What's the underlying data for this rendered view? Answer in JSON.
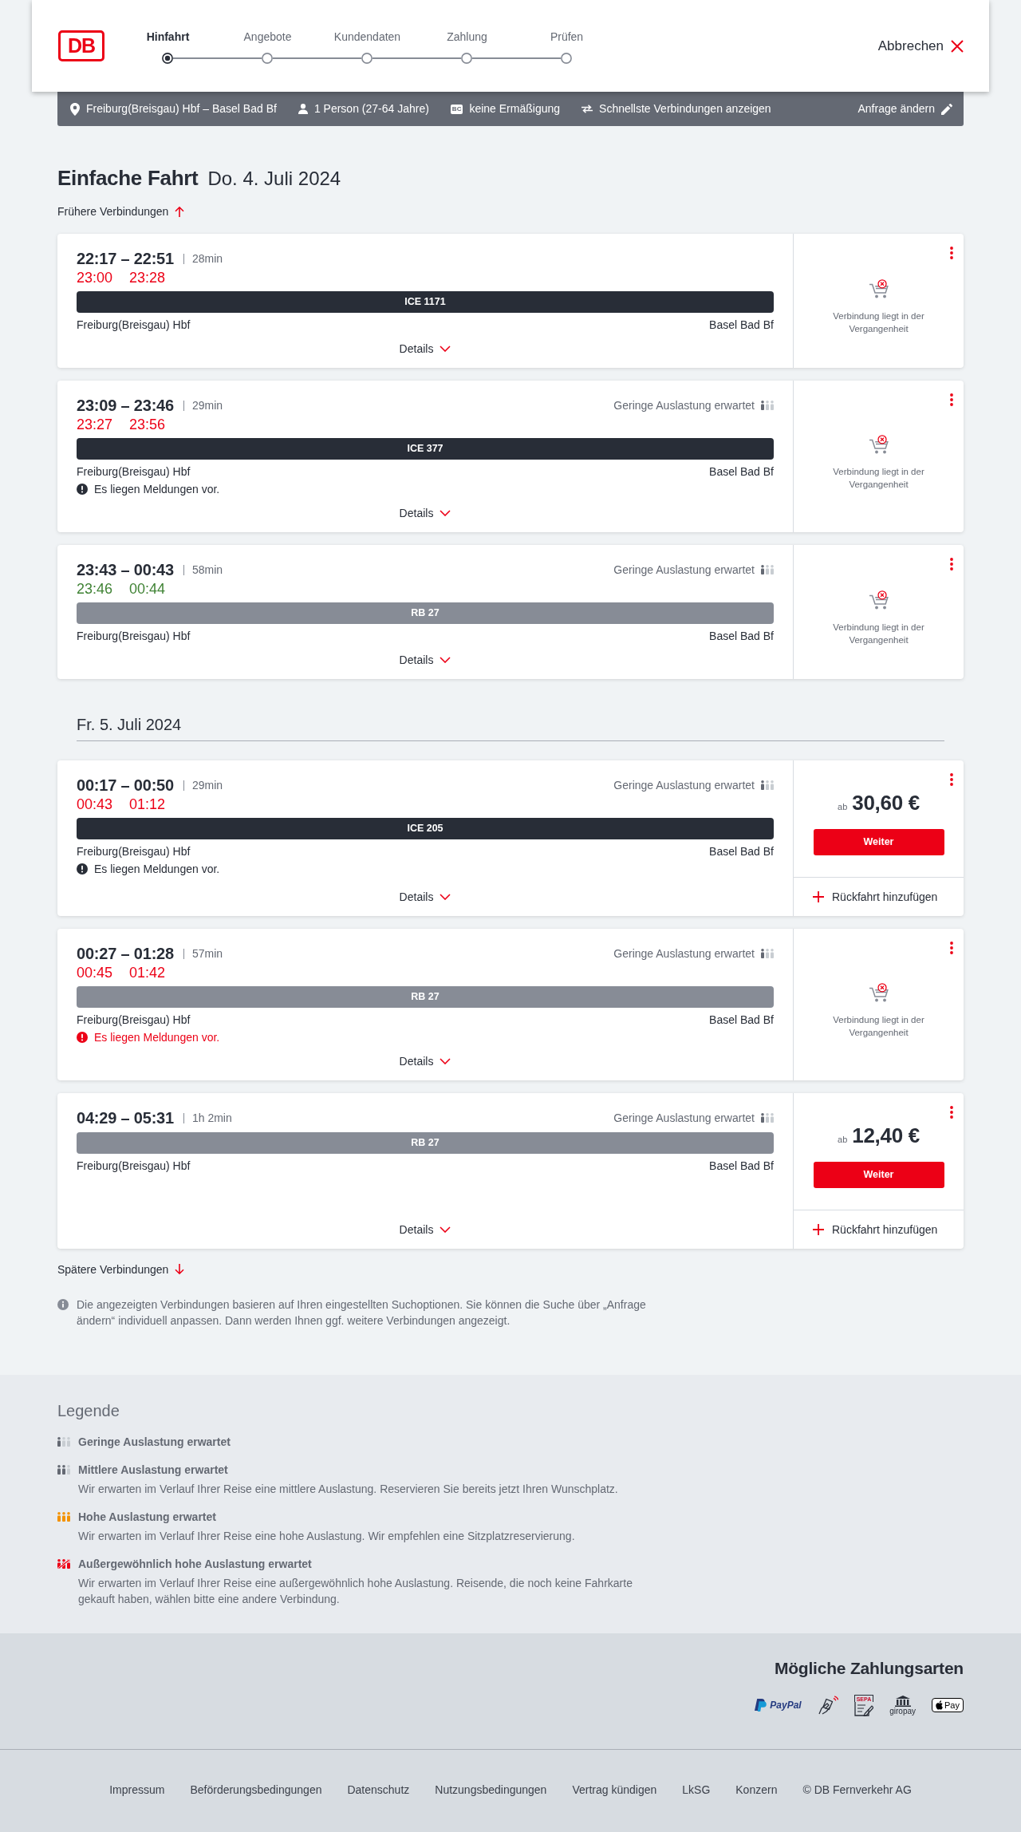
{
  "header": {
    "logo": "DB",
    "steps": [
      {
        "label": "Hinfahrt",
        "selected": true
      },
      {
        "label": "Angebote",
        "selected": false
      },
      {
        "label": "Kundendaten",
        "selected": false
      },
      {
        "label": "Zahlung",
        "selected": false
      },
      {
        "label": "Prüfen",
        "selected": false
      }
    ],
    "cancel": "Abbrechen"
  },
  "search_summary": {
    "items": [
      {
        "kind": "route",
        "text": "Freiburg(Breisgau) Hbf – Basel Bad Bf"
      },
      {
        "kind": "person",
        "text": "1 Person (27-64 Jahre)"
      },
      {
        "kind": "discount",
        "badge": "BC",
        "text": "keine Ermäßigung"
      },
      {
        "kind": "option",
        "text": "Schnellste Verbindungen anzeigen"
      }
    ],
    "edit": "Anfrage ändern"
  },
  "title": {
    "trip": "Einfache Fahrt",
    "date": "Do. 4. Juli 2024"
  },
  "earlier": "Frühere Verbindungen",
  "groups": [
    {
      "connections": [
        {
          "time": "22:17 – 22:51",
          "duration": "28min",
          "realtime": [
            {
              "text": "23:00",
              "delayed": true
            },
            {
              "text": "23:28",
              "delayed": true
            }
          ],
          "train": {
            "label": "ICE 1171",
            "kind": "long_distance"
          },
          "from": "Freiburg(Breisgau) Hbf",
          "to": "Basel Bad Bf",
          "details": "Details",
          "offer": {
            "kind": "past",
            "text": "Verbindung liegt in der Vergangenheit"
          }
        },
        {
          "time": "23:09 – 23:46",
          "duration": "29min",
          "occupancy": {
            "kind": "low",
            "label": "Geringe Auslastung erwartet"
          },
          "realtime": [
            {
              "text": "23:27",
              "delayed": true
            },
            {
              "text": "23:56",
              "delayed": true
            }
          ],
          "train": {
            "label": "ICE 377",
            "kind": "long_distance"
          },
          "from": "Freiburg(Breisgau) Hbf",
          "to": "Basel Bad Bf",
          "message": {
            "text": "Es liegen Meldungen vor.",
            "warning": false
          },
          "details": "Details",
          "offer": {
            "kind": "past",
            "text": "Verbindung liegt in der Vergangenheit"
          }
        },
        {
          "time": "23:43 – 00:43",
          "duration": "58min",
          "occupancy": {
            "kind": "low",
            "label": "Geringe Auslastung erwartet"
          },
          "realtime": [
            {
              "text": "23:46",
              "delayed": false
            },
            {
              "text": "00:44",
              "delayed": false
            }
          ],
          "train": {
            "label": "RB 27",
            "kind": "regional"
          },
          "from": "Freiburg(Breisgau) Hbf",
          "to": "Basel Bad Bf",
          "details": "Details",
          "offer": {
            "kind": "past",
            "text": "Verbindung liegt in der Vergangenheit"
          }
        }
      ]
    },
    {
      "date_heading": "Fr. 5. Juli 2024",
      "connections": [
        {
          "time": "00:17 – 00:50",
          "duration": "29min",
          "occupancy": {
            "kind": "low",
            "label": "Geringe Auslastung erwartet"
          },
          "realtime": [
            {
              "text": "00:43",
              "delayed": true
            },
            {
              "text": "01:12",
              "delayed": true
            }
          ],
          "train": {
            "label": "ICE 205",
            "kind": "long_distance"
          },
          "from": "Freiburg(Breisgau) Hbf",
          "to": "Basel Bad Bf",
          "message": {
            "text": "Es liegen Meldungen vor.",
            "warning": false
          },
          "details": "Details",
          "offer": {
            "kind": "price",
            "prefix": "ab",
            "price": "30,60 €",
            "button": "Weiter",
            "return": "Rückfahrt hinzufügen"
          }
        },
        {
          "time": "00:27 – 01:28",
          "duration": "57min",
          "occupancy": {
            "kind": "low",
            "label": "Geringe Auslastung erwartet"
          },
          "realtime": [
            {
              "text": "00:45",
              "delayed": true
            },
            {
              "text": "01:42",
              "delayed": true
            }
          ],
          "train": {
            "label": "RB 27",
            "kind": "regional"
          },
          "from": "Freiburg(Breisgau) Hbf",
          "to": "Basel Bad Bf",
          "message": {
            "text": "Es liegen Meldungen vor.",
            "warning": true
          },
          "details": "Details",
          "offer": {
            "kind": "past",
            "text": "Verbindung liegt in der Vergangenheit"
          }
        },
        {
          "time": "04:29 – 05:31",
          "duration": "1h 2min",
          "occupancy": {
            "kind": "low",
            "label": "Geringe Auslastung erwartet"
          },
          "train": {
            "label": "RB 27",
            "kind": "regional"
          },
          "from": "Freiburg(Breisgau) Hbf",
          "to": "Basel Bad Bf",
          "details": "Details",
          "offer": {
            "kind": "price",
            "prefix": "ab",
            "price": "12,40 €",
            "button": "Weiter",
            "return": "Rückfahrt hinzufügen"
          }
        }
      ]
    }
  ],
  "later": "Spätere Verbindungen",
  "note": "Die angezeigten Verbindungen basieren auf Ihren eingestellten Suchoptionen. Sie können die Suche über „Anfrage ändern“ individuell anpassen. Dann werden Ihnen ggf. weitere Verbindungen angezeigt.",
  "legend": {
    "title": "Legende",
    "items": [
      {
        "kind": "low",
        "title": "Geringe Auslastung erwartet"
      },
      {
        "kind": "medium",
        "title": "Mittlere Auslastung erwartet",
        "text": "Wir erwarten im Verlauf Ihrer Reise eine mittlere Auslastung. Reservieren Sie bereits jetzt Ihren Wunschplatz."
      },
      {
        "kind": "high",
        "title": "Hohe Auslastung erwartet",
        "text": "Wir erwarten im Verlauf Ihrer Reise eine hohe Auslastung. Wir empfehlen eine Sitzplatzreservierung."
      },
      {
        "kind": "exceptional",
        "title": "Außergewöhnlich hohe Auslastung erwartet",
        "text": "Wir erwarten im Verlauf Ihrer Reise eine außergewöhnlich hohe Auslastung. Reisende, die noch keine Fahrkarte gekauft haben, wählen bitte eine andere Verbindung."
      }
    ]
  },
  "payment": {
    "title": "Mögliche Zahlungsarten",
    "methods": [
      {
        "kind": "paypal",
        "label": "PayPal"
      },
      {
        "kind": "contactless"
      },
      {
        "kind": "sepa",
        "label": "SEPA"
      },
      {
        "kind": "giropay",
        "label": "giropay"
      },
      {
        "kind": "applepay",
        "label": "Pay"
      }
    ]
  },
  "footer_links": [
    "Impressum",
    "Beförderungsbedingungen",
    "Datenschutz",
    "Nutzungsbedingungen",
    "Vertrag kündigen",
    "LkSG",
    "Konzern"
  ],
  "copyright": "© DB Fernverkehr AG"
}
